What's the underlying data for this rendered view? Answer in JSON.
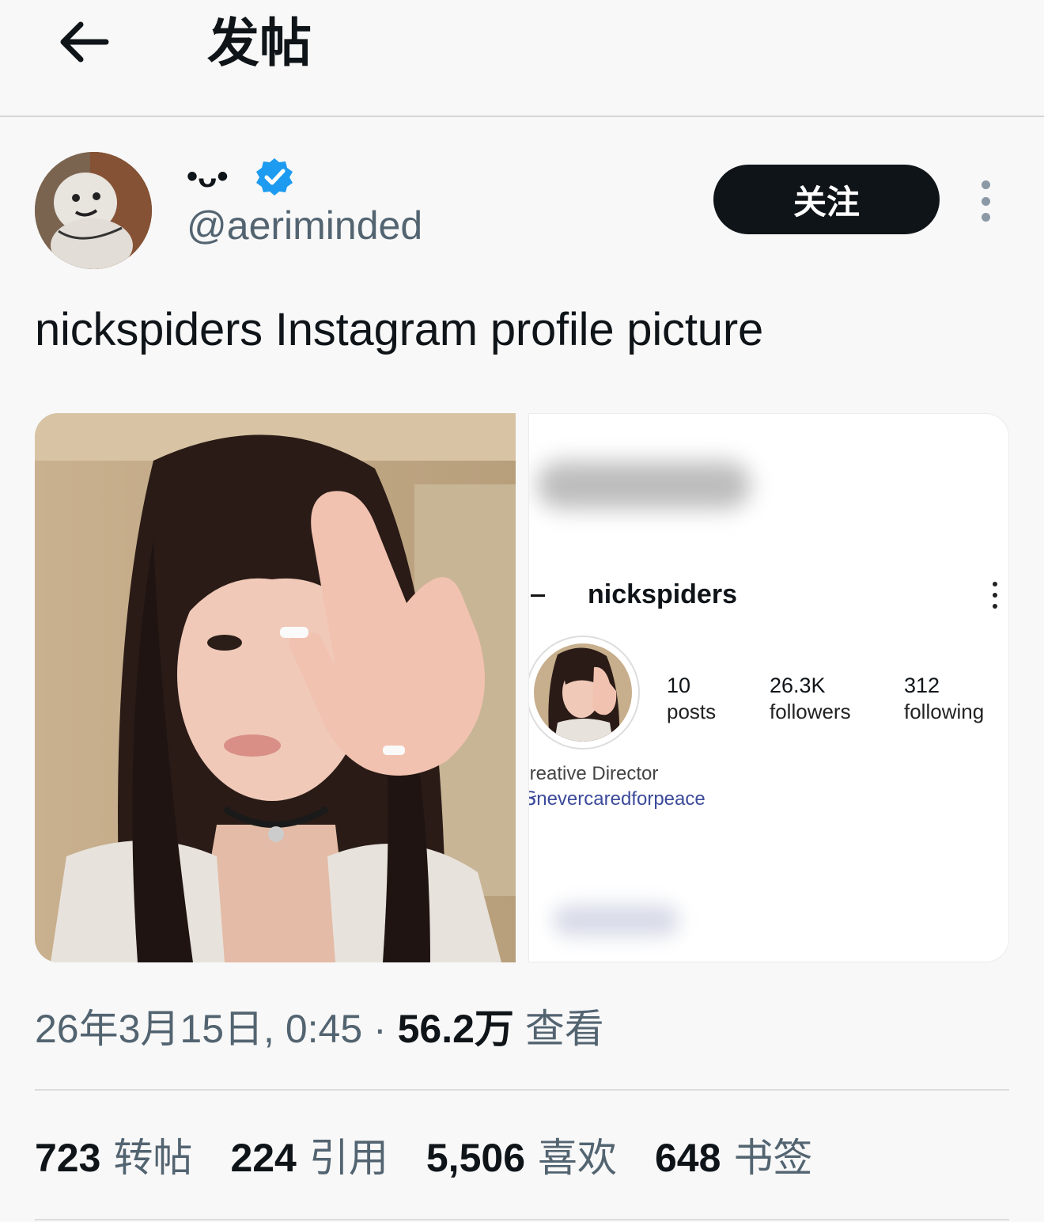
{
  "header": {
    "back_icon": "arrow-left-icon",
    "title": "发帖"
  },
  "author": {
    "display_name": "•ᴗ•",
    "verified_icon": "verified-badge-icon",
    "verified_color": "#1d9bf0",
    "handle": "@aeriminded",
    "follow_label": "关注",
    "more_icon": "more-vertical-icon"
  },
  "tweet": {
    "text": "nickspiders Instagram profile picture"
  },
  "media": {
    "left_image": "selfie-photo-peace-sign",
    "right_screenshot": {
      "username": "nickspiders",
      "stats": [
        {
          "value": "10",
          "label": "posts"
        },
        {
          "value": "26.3K",
          "label": "followers"
        },
        {
          "value": "312",
          "label": "following"
        }
      ],
      "bio_line1": ":reative Director",
      "bio_line2": "Ꞩnevercaredforpeace"
    }
  },
  "meta": {
    "datetime": "26年3月15日, 0:45 · ",
    "views_count": "56.2万",
    "views_label": "查看"
  },
  "engagement": [
    {
      "count": "723",
      "label": "转帖"
    },
    {
      "count": "224",
      "label": "引用"
    },
    {
      "count": "5,506",
      "label": "喜欢"
    },
    {
      "count": "648",
      "label": "书签"
    }
  ]
}
